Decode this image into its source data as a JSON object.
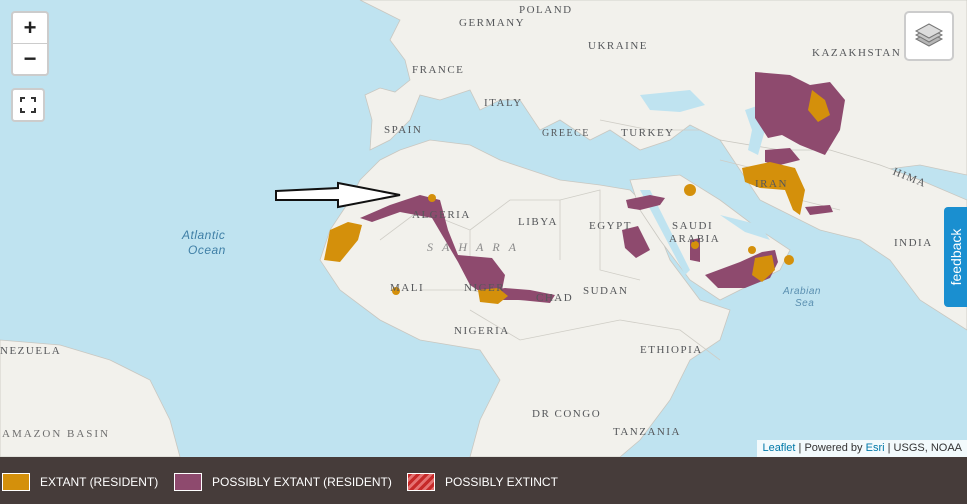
{
  "map": {
    "labels": {
      "germany": "GERMANY",
      "poland": "POLAND",
      "ukraine": "UKRAINE",
      "kazakhstan": "KAZAKHSTAN",
      "france": "FRANCE",
      "italy": "ITALY",
      "spain": "SPAIN",
      "greece": "GREECE",
      "turkey": "TURKEY",
      "iran": "IRAN",
      "himalaya": "HIMA",
      "algeria": "ALGERIA",
      "libya": "LIBYA",
      "egypt": "EGYPT",
      "saudi": "SAUDI",
      "arabia": "ARABIA",
      "india": "INDIA",
      "sahara": "SAHARA",
      "mali": "MALI",
      "niger": "NIGER",
      "chad": "CHAD",
      "sudan": "SUDAN",
      "nigeria": "NIGERIA",
      "ethiopia": "ETHIOPIA",
      "venezuela": "NEZUELA",
      "dr_congo": "DR CONGO",
      "tanzania": "TANZANIA",
      "amazon_basin": "AMAZON BASIN",
      "atlantic": "Atlantic",
      "ocean": "Ocean",
      "arabian": "Arabian",
      "sea": "Sea"
    },
    "controls": {
      "zoom_in": "+",
      "zoom_out": "−"
    },
    "feedback_label": "feedback",
    "attribution": {
      "leaflet": "Leaflet",
      "powered_by": " | Powered by ",
      "esri": "Esri",
      "sources": " | USGS, NOAA"
    }
  },
  "legend": {
    "items": [
      {
        "label": "EXTANT (RESIDENT)",
        "color": "#d4900b"
      },
      {
        "label": "POSSIBLY EXTANT (RESIDENT)",
        "color": "#8e4a6e"
      },
      {
        "label": "POSSIBLY EXTINCT",
        "color": "#c62a2a"
      }
    ]
  },
  "colors": {
    "ocean": "#bfe3f0",
    "land": "#f2f1ec",
    "extant": "#d4900b",
    "possibly_extant": "#8e4a6e",
    "legend_bg": "#463c3a"
  }
}
